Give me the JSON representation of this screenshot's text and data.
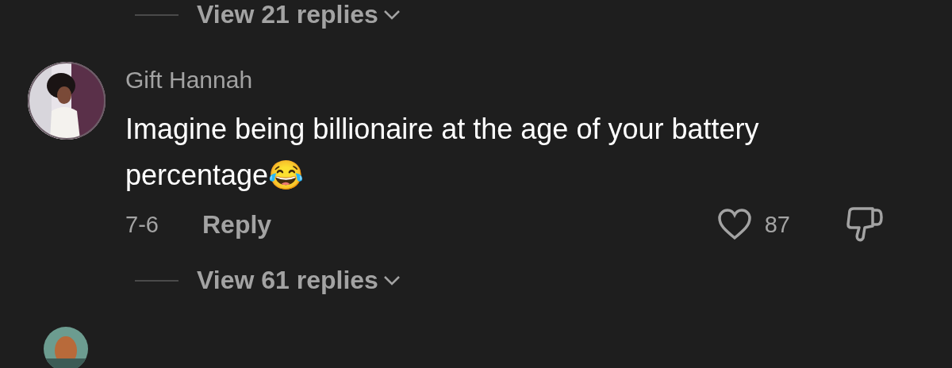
{
  "thread": [
    {
      "kind": "replies_toggle",
      "label": "View 21 replies"
    },
    {
      "kind": "comment",
      "author": "Gift Hannah",
      "text": "Imagine being billionaire at the age of your battery percentage😂",
      "date": "7-6",
      "reply": "Reply",
      "likes": "87",
      "liked": false
    },
    {
      "kind": "replies_toggle",
      "label": "View 61 replies"
    },
    {
      "kind": "comment_partial"
    }
  ]
}
